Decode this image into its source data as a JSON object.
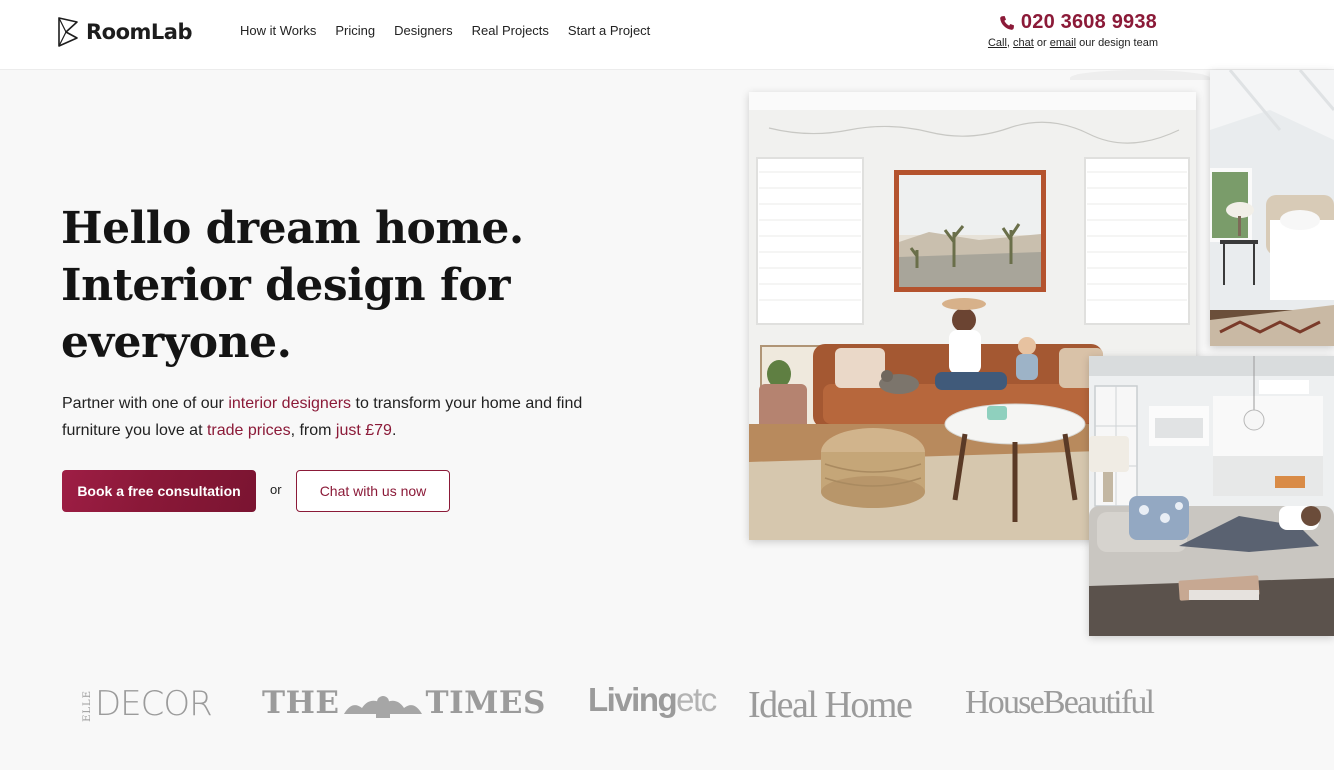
{
  "brand": {
    "name": "RoomLab"
  },
  "nav": {
    "items": [
      {
        "label": "How it Works"
      },
      {
        "label": "Pricing"
      },
      {
        "label": "Designers"
      },
      {
        "label": "Real Projects"
      },
      {
        "label": "Start a Project"
      }
    ]
  },
  "contact": {
    "phone": "020 3608 9938",
    "call_label": "Call",
    "chat_label": "chat",
    "or_label": "or",
    "email_label": "email",
    "suffix": "our design team"
  },
  "hero": {
    "title_line1": "Hello dream home.",
    "title_line2": "Interior design for",
    "title_line3": "everyone.",
    "sub_part1": "Partner with one of our ",
    "sub_link1": "interior designers",
    "sub_part2": " to transform your home and find furniture you love at ",
    "sub_link2": "trade prices",
    "sub_part3": ", from ",
    "sub_link3": "just £79",
    "sub_part4": "."
  },
  "cta": {
    "primary_label": "Book a free consultation",
    "or_label": "or",
    "secondary_label": "Chat with us now"
  },
  "press": {
    "elle_prefix": "ELLE",
    "elle_main": "DECOR",
    "times_left": "THE",
    "times_right": "TIMES",
    "living_main": "Living",
    "living_suffix": "etc",
    "ideal": "Ideal Home",
    "house": "HouseBeautiful"
  },
  "colors": {
    "accent": "#8b1a38",
    "background": "#f8f8f8",
    "header_bg": "#ffffff",
    "press_gray": "#9b9b9b"
  },
  "icons": {
    "logo": "roomlab-logo-icon",
    "phone": "phone-icon"
  }
}
